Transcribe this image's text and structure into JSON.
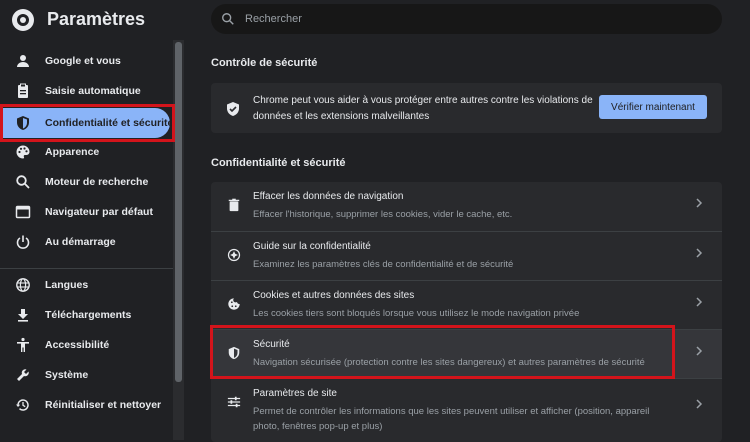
{
  "app": {
    "title": "Paramètres"
  },
  "search": {
    "placeholder": "Rechercher"
  },
  "sidebar": {
    "items": [
      {
        "label": "Google et vous",
        "icon": "person-icon"
      },
      {
        "label": "Saisie automatique",
        "icon": "clipboard-icon"
      },
      {
        "label": "Confidentialité et sécurité",
        "icon": "shield-icon",
        "active": true
      },
      {
        "label": "Apparence",
        "icon": "palette-icon"
      },
      {
        "label": "Moteur de recherche",
        "icon": "search-icon"
      },
      {
        "label": "Navigateur par défaut",
        "icon": "browser-icon"
      },
      {
        "label": "Au démarrage",
        "icon": "power-icon"
      },
      {
        "label": "Langues",
        "icon": "globe-icon"
      },
      {
        "label": "Téléchargements",
        "icon": "download-icon"
      },
      {
        "label": "Accessibilité",
        "icon": "accessibility-icon"
      },
      {
        "label": "Système",
        "icon": "wrench-icon"
      },
      {
        "label": "Réinitialiser et nettoyer",
        "icon": "restore-icon"
      }
    ]
  },
  "safety_check": {
    "title": "Contrôle de sécurité",
    "text": "Chrome peut vous aider à vous protéger entre autres contre les violations de données et les extensions malveillantes",
    "button": "Vérifier maintenant"
  },
  "privacy": {
    "title": "Confidentialité et sécurité",
    "rows": [
      {
        "title": "Effacer les données de navigation",
        "desc": "Effacer l'historique, supprimer les cookies, vider le cache, etc.",
        "icon": "trash-icon"
      },
      {
        "title": "Guide sur la confidentialité",
        "desc": "Examinez les paramètres clés de confidentialité et de sécurité",
        "icon": "compass-icon"
      },
      {
        "title": "Cookies et autres données des sites",
        "desc": "Les cookies tiers sont bloqués lorsque vous utilisez le mode navigation privée",
        "icon": "cookie-icon"
      },
      {
        "title": "Sécurité",
        "desc": "Navigation sécurisée (protection contre les sites dangereux) et autres paramètres de sécurité",
        "icon": "security-shield-icon",
        "selected": true
      },
      {
        "title": "Paramètres de site",
        "desc": "Permet de contrôler les informations que les sites peuvent utiliser et afficher (position, appareil photo, fenêtres pop-up et plus)",
        "icon": "sliders-icon"
      }
    ]
  },
  "colors": {
    "accent": "#8ab4f8",
    "highlight": "#d3141b",
    "background": "#202124",
    "card": "#292a2d"
  }
}
